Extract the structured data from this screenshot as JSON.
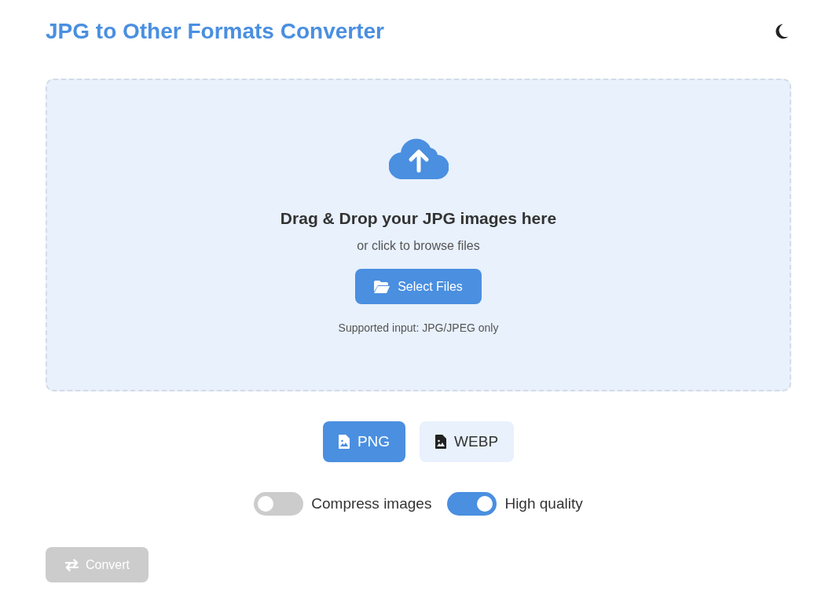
{
  "header": {
    "title": "JPG to Other Formats Converter"
  },
  "dropzone": {
    "heading": "Drag & Drop your JPG images here",
    "subtext": "or click to browse files",
    "button": "Select Files",
    "note": "Supported input: JPG/JPEG only"
  },
  "formats": [
    {
      "label": "PNG",
      "selected": true
    },
    {
      "label": "WEBP",
      "selected": false
    }
  ],
  "options": [
    {
      "label": "Compress images",
      "on": false
    },
    {
      "label": "High quality",
      "on": true
    }
  ],
  "convert": {
    "label": "Convert",
    "disabled": true
  }
}
